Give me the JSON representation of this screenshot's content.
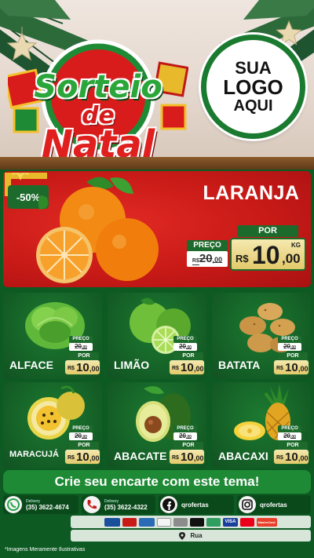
{
  "header": {
    "title_line1": "Sorteio",
    "title_line2": "de",
    "title_line3": "Natal",
    "logo_line1": "SUA",
    "logo_line2": "LOGO",
    "logo_line3": "AQUI"
  },
  "hero": {
    "discount": "-50%",
    "name": "LARANJA",
    "old_label": "PREÇO",
    "old_price": "R$20,00",
    "old_price_int": "20",
    "old_price_dec": ",00",
    "old_price_cur": "R$",
    "por_label": "POR",
    "currency": "R$",
    "price_int": "10",
    "price_dec": ",00",
    "unit": "KG"
  },
  "products": [
    {
      "name": "ALFACE",
      "old_label": "PREÇO",
      "old_price": "R$20,00",
      "old_price_int": "20",
      "old_price_dec": ",00",
      "por_label": "POR",
      "currency": "R$",
      "price_int": "10",
      "price_dec": ",00",
      "icon": "lettuce-image"
    },
    {
      "name": "LIMÃO",
      "old_label": "PREÇO",
      "old_price": "R$20,00",
      "old_price_int": "20",
      "old_price_dec": ",00",
      "por_label": "POR",
      "currency": "R$",
      "price_int": "10",
      "price_dec": ",00",
      "icon": "lime-image"
    },
    {
      "name": "BATATA",
      "old_label": "PREÇO",
      "old_price": "R$20,00",
      "old_price_int": "20",
      "old_price_dec": ",00",
      "por_label": "POR",
      "currency": "R$",
      "price_int": "10",
      "price_dec": ",00",
      "icon": "potato-image"
    },
    {
      "name": "MARACUJÁ",
      "old_label": "PREÇO",
      "old_price": "R$20,00",
      "old_price_int": "20",
      "old_price_dec": ",00",
      "por_label": "POR",
      "currency": "R$",
      "price_int": "10",
      "price_dec": ",00",
      "icon": "passion-fruit-image"
    },
    {
      "name": "ABACATE",
      "old_label": "PREÇO",
      "old_price": "R$20,00",
      "old_price_int": "20",
      "old_price_dec": ",00",
      "por_label": "POR",
      "currency": "R$",
      "price_int": "10",
      "price_dec": ",00",
      "icon": "avocado-image"
    },
    {
      "name": "ABACAXI",
      "old_label": "PREÇO",
      "old_price": "R$20,00",
      "old_price_int": "20",
      "old_price_dec": ",00",
      "por_label": "POR",
      "currency": "R$",
      "price_int": "10",
      "price_dec": ",00",
      "icon": "pineapple-image"
    }
  ],
  "footer": {
    "cta": "Crie seu encarte com este tema!",
    "whatsapp_label": "Delivery",
    "whatsapp_number": "(35) 3622-4674",
    "phone_label": "Delivery",
    "phone_number": "(35) 3622-4322",
    "facebook": "qrofertas",
    "instagram": "qrofertas",
    "payments": [
      "VISA",
      "MasterCard"
    ],
    "address": "Rua",
    "disclaimer": "*Imagens Meramente Ilustrativas"
  },
  "colors": {
    "green_dark": "#115222",
    "green": "#1d6b2c",
    "red": "#c81a17",
    "gold": "#e3c96a"
  }
}
